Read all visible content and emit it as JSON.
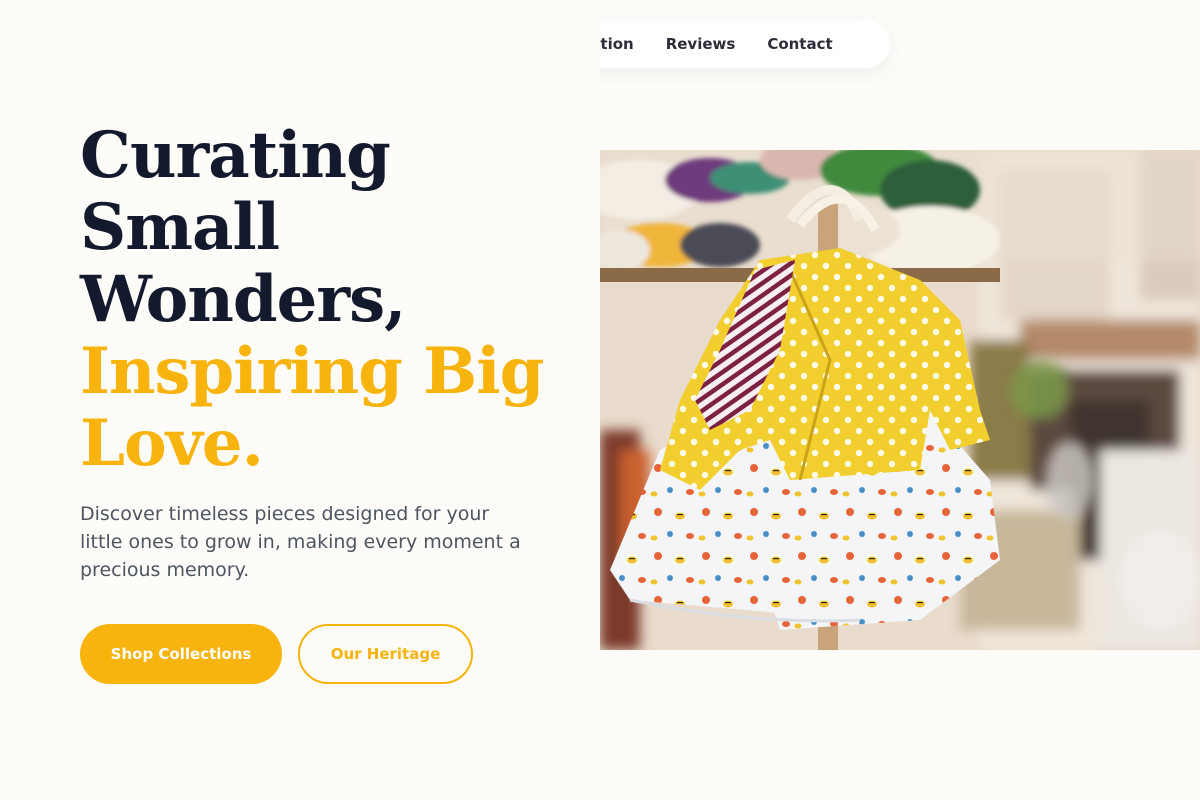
{
  "nav": {
    "items": [
      {
        "label": "piration"
      },
      {
        "label": "Reviews"
      },
      {
        "label": "Contact"
      }
    ]
  },
  "hero": {
    "title_lines": [
      "Curating",
      "Small",
      "Wonders,"
    ],
    "accent_lines": [
      "Inspiring Big",
      "Love."
    ],
    "description": "Discover timeless pieces designed for your little ones to grow in, making every moment a precious memory.",
    "primary_button": "Shop Collections",
    "secondary_button": "Our Heritage"
  },
  "colors": {
    "accent": "#f8b30d",
    "heading": "#141a2e",
    "body_text": "#4d5560",
    "background": "#fdfcf8"
  },
  "image": {
    "subject": "children-clothes-rack-photo"
  }
}
